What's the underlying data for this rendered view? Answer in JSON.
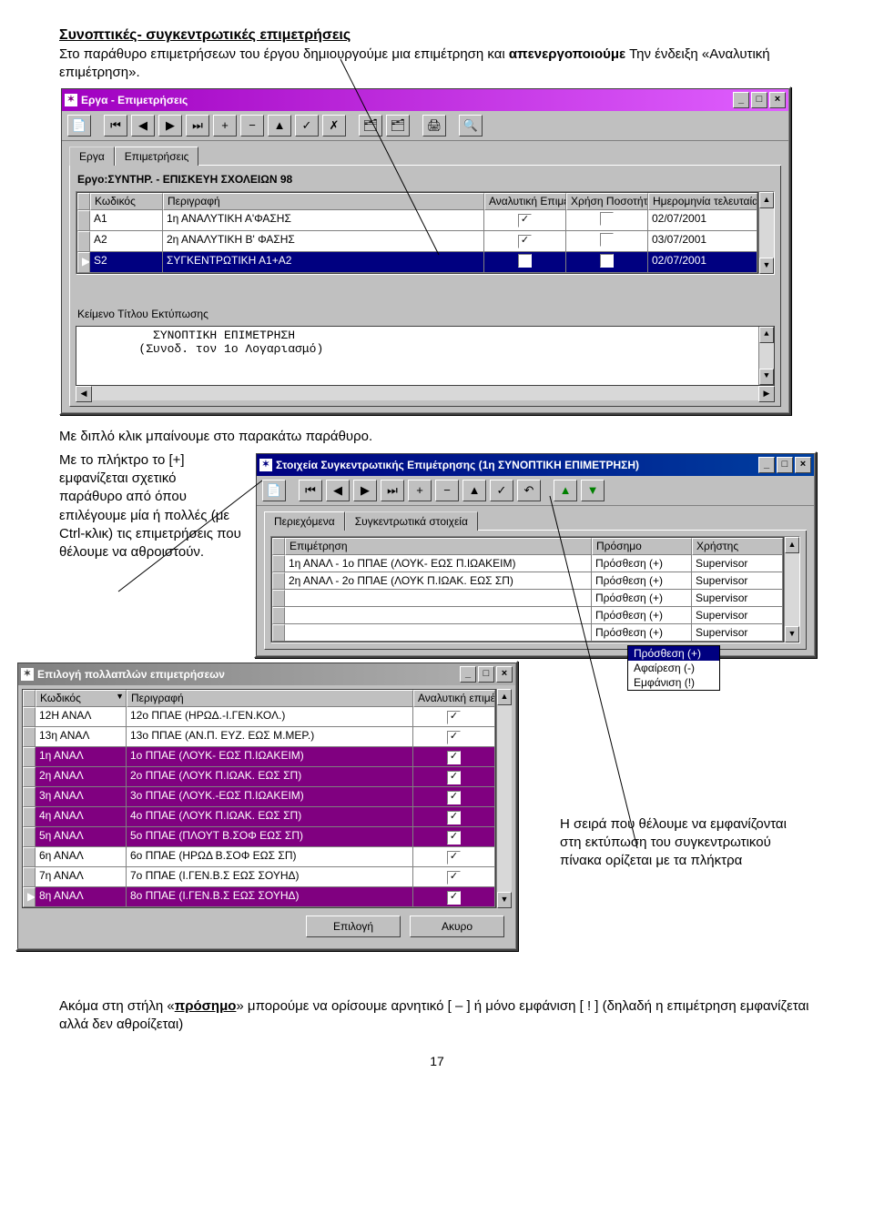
{
  "text": {
    "heading": "Συνοπτικές- συγκεντρωτικές επιμετρήσεις",
    "p1a": "Στο παράθυρο επιμετρήσεων του έργου δημιουργούμε μια επιμέτρηση και ",
    "p1b": "απενεργοποιούμε",
    "p1c": " Την ένδειξη «Αναλυτική επιμέτρηση».",
    "p2": "Με διπλό κλικ μπαίνουμε στο παρακάτω παράθυρο.",
    "p3": "Με το πλήκτρο το [+] εμφανίζεται σχετικό παράθυρο από όπου επιλέγουμε μία ή πολλές (με Ctrl-κλικ) τις επιμετρήσεις που θέλουμε να αθροιστούν.",
    "p4": "Η σειρά που θέλουμε να εμφανίζονται στη εκτύπωση του συγκεντρωτικού πίνακα ορίζεται με τα πλήκτρα",
    "p5a": "Ακόμα στη στήλη «",
    "p5b": "πρόσημο",
    "p5c": "» μπορούμε να ορίσουμε αρνητικό [ – ] ή μόνο εμφάνιση [ ! ] (δηλαδή η επιμέτρηση εμφανίζεται αλλά δεν αθροίζεται)",
    "pagenum": "17"
  },
  "win1": {
    "title": "Εργα - Επιμετρήσεις",
    "tabs": [
      "Εργα",
      "Επιμετρήσεις"
    ],
    "proj": "Εργο:ΣΥΝΤΗΡ. - ΕΠΙΣΚΕΥΗ ΣΧΟΛΕΙΩΝ 98",
    "hdr": [
      "Κωδικός",
      "Περιγραφή",
      "Αναλυτική Επιμέτρηση",
      "Χρήση Ποσοτήτων Χρήστη",
      "Ημερομηνία τελευταίας επεξεργασίας"
    ],
    "rows": [
      {
        "m": "",
        "c": "A1",
        "d": "1η ΑΝΑΛΥΤΙΚΗ  Α'ΦΑΣΗΣ",
        "a": true,
        "x": false,
        "dt": "02/07/2001"
      },
      {
        "m": "",
        "c": "A2",
        "d": "2η ΑΝΑΛΥΤΙΚΗ Β' ΦΑΣΗΣ",
        "a": true,
        "x": false,
        "dt": "03/07/2001"
      },
      {
        "m": "▶",
        "c": "S2",
        "d": "ΣΥΓΚΕΝΤΡΩΤΙΚΗ Α1+Α2",
        "a": false,
        "x": false,
        "dt": "02/07/2001",
        "sel": true
      }
    ],
    "titleprint": "Κείμενο Τίτλου Εκτύπωσης",
    "memo": "          ΣΥΝΟΠΤΙΚΗ ΕΠΙΜΕΤΡΗΣΗ\n        (Συνοδ. τον 1ο Λογαριασμό)"
  },
  "win2": {
    "title": "Στοιχεία Συγκεντρωτικής Επιμέτρησης (1η ΣΥΝΟΠΤΙΚΗ ΕΠΙΜΕΤΡΗΣΗ)",
    "tabs": [
      "Περιεχόμενα",
      "Συγκεντρωτικά στοιχεία"
    ],
    "hdr": [
      "Επιμέτρηση",
      "Πρόσημο",
      "Χρήστης"
    ],
    "rows": [
      {
        "e": "1η ΑΝΑΛ - 1ο ΠΠΑΕ (ΛΟΥΚ- ΕΩΣ Π.ΙΩΑΚΕΙΜ)",
        "p": "Πρόσθεση (+)",
        "u": "Supervisor"
      },
      {
        "e": "2η ΑΝΑΛ - 2ο ΠΠΑΕ (ΛΟΥΚ Π.ΙΩΑΚ. ΕΩΣ ΣΠ)",
        "p": "Πρόσθεση (+)",
        "u": "Supervisor"
      },
      {
        "e": "",
        "p": "Πρόσθεση (+)",
        "u": "Supervisor"
      },
      {
        "e": "",
        "p": "Πρόσθεση (+)",
        "u": "Supervisor"
      },
      {
        "e": "",
        "p": "Πρόσθεση (+)",
        "u": "Supervisor"
      }
    ],
    "popup": [
      "Πρόσθεση (+)",
      "Αφαίρεση (-)",
      "Εμφάνιση (!)"
    ]
  },
  "win3": {
    "title": "Επιλογή πολλαπλών επιμετρήσεων",
    "hdr": [
      "Κωδικός",
      "Περιγραφή",
      "Αναλυτική επιμέτρηση"
    ],
    "rows": [
      {
        "c": "12Η ΑΝΑΛ",
        "d": "12ο ΠΠΑΕ (ΗΡΩΔ.-Ι.ΓΕΝ.ΚΟΛ.)",
        "a": true,
        "sel": false
      },
      {
        "c": "13η ΑΝΑΛ",
        "d": "13ο ΠΠΑΕ (ΑΝ.Π. ΕΥΖ. ΕΩΣ Μ.ΜΕΡ.)",
        "a": true,
        "sel": false
      },
      {
        "c": "1η ΑΝΑΛ",
        "d": "1ο ΠΠΑΕ (ΛΟΥΚ- ΕΩΣ Π.ΙΩΑΚΕΙΜ)",
        "a": true,
        "sel": true
      },
      {
        "c": "2η ΑΝΑΛ",
        "d": "2ο ΠΠΑΕ (ΛΟΥΚ Π.ΙΩΑΚ. ΕΩΣ ΣΠ)",
        "a": true,
        "sel": true
      },
      {
        "c": "3η ΑΝΑΛ",
        "d": "3ο ΠΠΑΕ (ΛΟΥΚ.-ΕΩΣ Π.ΙΩΑΚΕΙΜ)",
        "a": true,
        "sel": true
      },
      {
        "c": "4η ΑΝΑΛ",
        "d": "4ο ΠΠΑΕ (ΛΟΥΚ Π.ΙΩΑΚ. ΕΩΣ ΣΠ)",
        "a": true,
        "sel": true
      },
      {
        "c": "5η ΑΝΑΛ",
        "d": "5ο ΠΠΑΕ (ΠΛΟΥΤ Β.ΣΟΦ ΕΩΣ ΣΠ)",
        "a": true,
        "sel": true
      },
      {
        "c": "6η ΑΝΑΛ",
        "d": "6ο ΠΠΑΕ (ΗΡΩΔ Β.ΣΟΦ ΕΩΣ ΣΠ)",
        "a": true,
        "sel": false
      },
      {
        "c": "7η ΑΝΑΛ",
        "d": "7ο ΠΠΑΕ (Ι.ΓΕΝ.Β.Σ ΕΩΣ ΣΟΥΗΔ)",
        "a": true,
        "sel": false
      },
      {
        "c": "8η ΑΝΑΛ",
        "d": "8ο ΠΠΑΕ (Ι.ΓΕΝ.Β.Σ ΕΩΣ ΣΟΥΗΔ)",
        "a": true,
        "sel": true,
        "mark": "▶"
      }
    ],
    "buttons": [
      "Επιλογή",
      "Ακυρο"
    ]
  }
}
